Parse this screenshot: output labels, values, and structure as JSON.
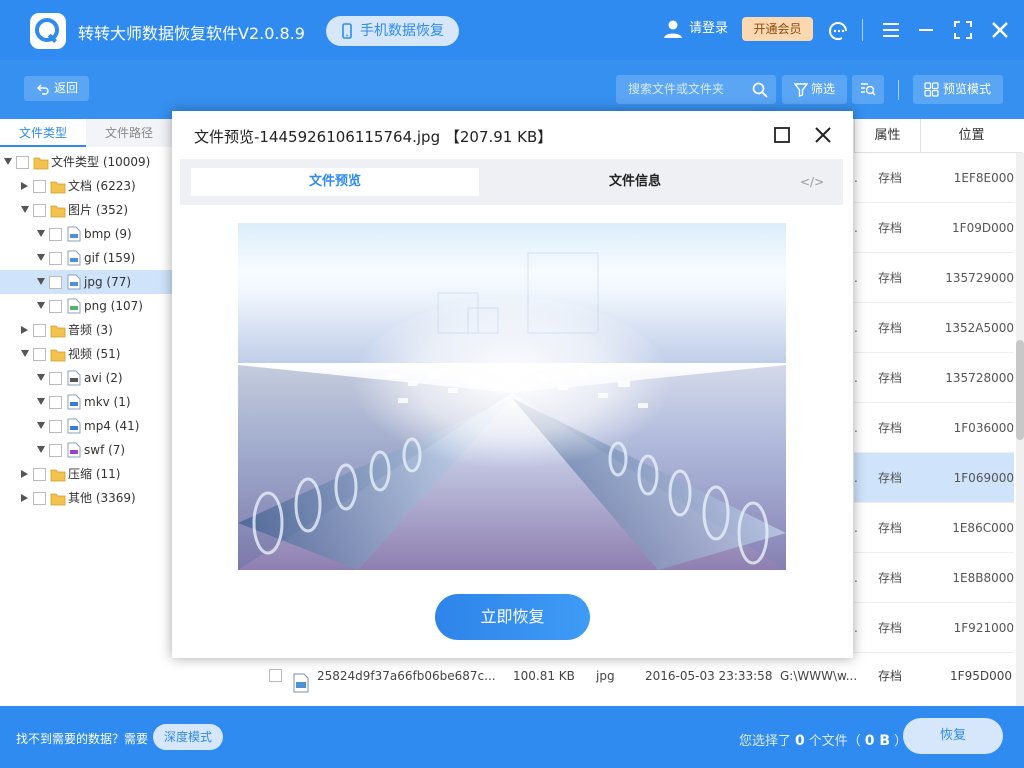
{
  "app": {
    "title": "转转大师数据恢复软件V2.0.8.9",
    "mobile_recovery": "手机数据恢复",
    "login": "请登录",
    "vip": "开通会员"
  },
  "toolbar": {
    "back": "返回",
    "search_placeholder": "搜索文件或文件夹",
    "filter": "筛选",
    "preview_mode": "预览模式"
  },
  "sidebar": {
    "tabs": [
      "文件类型",
      "文件路径"
    ],
    "tree": [
      {
        "label": "文件类型 (10009)",
        "level": 0,
        "state": "expanded"
      },
      {
        "label": "文档 (6223)",
        "level": 1,
        "state": "collapsed"
      },
      {
        "label": "图片 (352)",
        "level": 1,
        "state": "expanded"
      },
      {
        "label": "bmp (9)",
        "level": 2,
        "state": "expanded"
      },
      {
        "label": "gif (159)",
        "level": 2,
        "state": "expanded"
      },
      {
        "label": "jpg (77)",
        "level": 2,
        "state": "expanded",
        "selected": true
      },
      {
        "label": "png (107)",
        "level": 2,
        "state": "expanded"
      },
      {
        "label": "音频 (3)",
        "level": 1,
        "state": "collapsed"
      },
      {
        "label": "视频 (51)",
        "level": 1,
        "state": "expanded"
      },
      {
        "label": "avi (2)",
        "level": 2,
        "state": "expanded"
      },
      {
        "label": "mkv (1)",
        "level": 2,
        "state": "expanded"
      },
      {
        "label": "mp4 (41)",
        "level": 2,
        "state": "expanded"
      },
      {
        "label": "swf (7)",
        "level": 2,
        "state": "expanded"
      },
      {
        "label": "压缩 (11)",
        "level": 1,
        "state": "collapsed"
      },
      {
        "label": "其他 (3369)",
        "level": 1,
        "state": "collapsed"
      }
    ]
  },
  "table": {
    "headers": [
      "属性",
      "位置"
    ],
    "rows": [
      {
        "attr": "存档",
        "pos": "1EF8E000",
        "trunc": "."
      },
      {
        "attr": "存档",
        "pos": "1F09D000",
        "trunc": "."
      },
      {
        "attr": "存档",
        "pos": "135729000",
        "trunc": "."
      },
      {
        "attr": "存档",
        "pos": "1352A5000",
        "trunc": "."
      },
      {
        "attr": "存档",
        "pos": "135728000",
        "trunc": "."
      },
      {
        "attr": "存档",
        "pos": "1F036000",
        "trunc": "."
      },
      {
        "attr": "存档",
        "pos": "1F069000",
        "trunc": ".",
        "selected": true
      },
      {
        "attr": "存档",
        "pos": "1E86C000",
        "trunc": "."
      },
      {
        "attr": "存档",
        "pos": "1E8B8000",
        "trunc": "."
      },
      {
        "attr": "存档",
        "pos": "1F921000",
        "trunc": "."
      }
    ],
    "last_row": {
      "name": "25824d9f37a66fb06be687c...",
      "size": "100.81 KB",
      "type": "jpg",
      "date": "2016-05-03 23:33:58",
      "path": "G:\\WWW\\w...",
      "attr": "存档",
      "pos": "1F95D000"
    }
  },
  "bottom": {
    "not_found": "找不到需要的数据？需要",
    "deep_mode": "深度模式",
    "selected_prefix": "您选择了",
    "selected_count": "0",
    "selected_mid": "个文件（",
    "selected_size": "0 B",
    "selected_suffix": "）",
    "recover": "恢复"
  },
  "dialog": {
    "title": "文件预览-1445926106115764.jpg 【207.91 KB】",
    "tab_preview": "文件预览",
    "tab_info": "文件信息",
    "code_icon": "</>",
    "recover_now": "立即恢复"
  },
  "colors": {
    "primary": "#2f8bef",
    "toolbar": "#3690f0",
    "selection": "#cfe3fb",
    "vip": "#fbd8b0"
  }
}
